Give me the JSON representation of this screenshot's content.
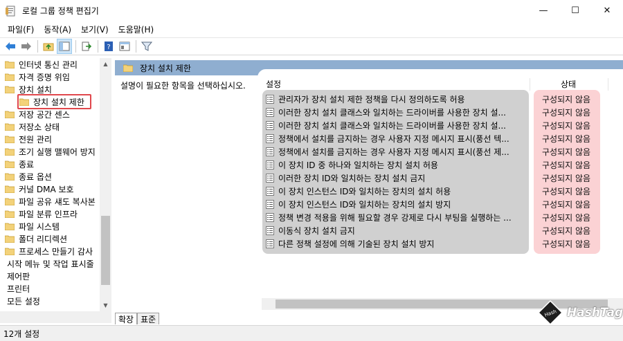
{
  "window": {
    "title": "로컬 그룹 정책 편집기",
    "minimize": "—",
    "maximize": "☐",
    "close": "✕"
  },
  "menu": [
    "파일(F)",
    "동작(A)",
    "보기(V)",
    "도움말(H)"
  ],
  "tree": {
    "items": [
      {
        "label": "인터넷 통신 관리"
      },
      {
        "label": "자격 증명 위임"
      },
      {
        "label": "장치 설치"
      },
      {
        "label": "장치 설치 제한"
      },
      {
        "label": "저장 공간 센스"
      },
      {
        "label": "저장소 상태"
      },
      {
        "label": "전원 관리"
      },
      {
        "label": "조기 실행 맬웨어 방지"
      },
      {
        "label": "종료"
      },
      {
        "label": "종료 옵션"
      },
      {
        "label": "커널 DMA 보호"
      },
      {
        "label": "파일 공유 섀도 복사본"
      },
      {
        "label": "파일 분류 인프라"
      },
      {
        "label": "파일 시스템"
      },
      {
        "label": "폴더 리디렉션"
      },
      {
        "label": "프로세스 만들기 감사"
      },
      {
        "label": "시작 메뉴 및 작업 표시줄"
      },
      {
        "label": "제어판"
      },
      {
        "label": "프린터"
      },
      {
        "label": "모든 설정"
      }
    ]
  },
  "right": {
    "header_title": "장치 설치 제한",
    "description": "설명이 필요한 항목을 선택하십시오.",
    "col_setting": "설정",
    "col_state": "상태",
    "rows": [
      {
        "setting": "관리자가 장치 설치 제한 정책을 다시 정의하도록 허용",
        "state": "구성되지 않음"
      },
      {
        "setting": "이러한 장치 설치 클래스와 일치하는 드라이버를 사용한 장치 설...",
        "state": "구성되지 않음"
      },
      {
        "setting": "이러한 장치 설치 클래스와 일치하는 드라이버를 사용한 장치 설...",
        "state": "구성되지 않음"
      },
      {
        "setting": "정책에서 설치를 금지하는 경우 사용자 지정 메시지 표시(풍선 텍...",
        "state": "구성되지 않음"
      },
      {
        "setting": "정책에서 설치를 금지하는 경우 사용자 지정 메시지 표시(풍선 제...",
        "state": "구성되지 않음"
      },
      {
        "setting": "이 장치 ID 중 하나와 일치하는 장치 설치 허용",
        "state": "구성되지 않음"
      },
      {
        "setting": "이러한 장치 ID와 일치하는 장치 설치 금지",
        "state": "구성되지 않음"
      },
      {
        "setting": "이 장치 인스턴스 ID와 일치하는 장치의 설치 허용",
        "state": "구성되지 않음"
      },
      {
        "setting": "이 장치 인스턴스 ID와 일치하는 장치의 설치 방지",
        "state": "구성되지 않음"
      },
      {
        "setting": "정책 변경 적용을 위해 필요할 경우 강제로 다시 부팅을 실행하는 ...",
        "state": "구성되지 않음"
      },
      {
        "setting": "이동식 장치 설치 금지",
        "state": "구성되지 않음"
      },
      {
        "setting": "다른 정책 설정에 의해 기술된 장치 설치 방지",
        "state": "구성되지 않음"
      }
    ]
  },
  "tabs": [
    "확장",
    "표준"
  ],
  "status": "12개 설정",
  "watermark": "HashTag",
  "colors": {
    "header": "#8faed0",
    "highlight": "#e0474c",
    "state_bg": "#fbd2d4",
    "settings_bg": "#d0d0d0",
    "folder": "#f3d27a"
  }
}
